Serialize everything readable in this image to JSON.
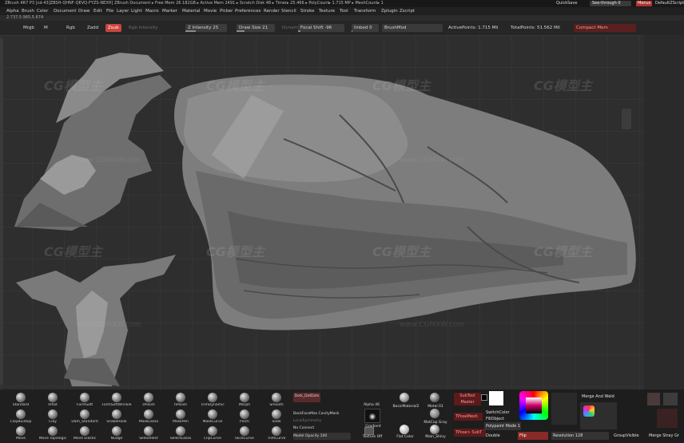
{
  "titlebar": {
    "app_info": "ZBrush 4R7 P3 [cd-43]ZBSH-QHNF-QEVQ-FYZS-NEXH]   ZBrush Document      ▸ Free Mem 26.182GB ▸ Active Mem 2491 ▸ Scratch Disk 48 ▸ Timer▸ 25.466 ▸ PolyCount▸ 1.715 MP ▸ MeshCount▸ 1",
    "quicksave": "QuickSave",
    "see_through": "See-through  0",
    "menus": "Menus",
    "default_script": "DefaultZScript"
  },
  "menubar": {
    "items": [
      "Alpha",
      "Brush",
      "Color",
      "Document",
      "Draw",
      "Edit",
      "File",
      "Layer",
      "Light",
      "Macro",
      "Marker",
      "Material",
      "Movie",
      "Picker",
      "Preferences",
      "Render",
      "Stencil",
      "Stroke",
      "Texture",
      "Tool",
      "Transform",
      "Zplugin",
      "Zscript"
    ]
  },
  "coords": "2.737,5.965,5.674",
  "toolrow": {
    "mrgb": "Mrgb",
    "m": "M",
    "rgb": "Rgb",
    "zadd": "Zadd",
    "zsub": "Zsub",
    "rgb_intensity": "Rgb Intensity",
    "z_intensity": "Z Intensity 25",
    "draw_size": "Draw Size 21",
    "dynamic": "Dynamic",
    "focal_shift": "Focal Shift -96",
    "imbed": "Imbed 0",
    "brushmod": "BrushMod",
    "active_points": "ActivePoints: 1.715 Mil",
    "total_points": "TotalPoints: 51.562 Mil",
    "compact_mem": "Compact Mem"
  },
  "watermarks": {
    "logo": "CG模型主",
    "url": "www.CGMXW.com"
  },
  "palette_left": {
    "brushes": [
      {
        "label": "Standard"
      },
      {
        "label": "Inflat"
      },
      {
        "label": "FormSoft"
      },
      {
        "label": "FormSoftWrinkle"
      },
      {
        "label": "zPolish"
      },
      {
        "label": "hPolish"
      },
      {
        "label": "TrimDynamic"
      },
      {
        "label": "Morph"
      },
      {
        "label": "Smooth"
      },
      {
        "label": "ClayBuildup"
      },
      {
        "label": "Clay"
      },
      {
        "label": "Dam_Standard"
      },
      {
        "label": "SnakeHook"
      },
      {
        "label": "MaskLasso"
      },
      {
        "label": "MaskPen"
      },
      {
        "label": "MaskCurve"
      },
      {
        "label": "Pinch"
      },
      {
        "label": "Slide"
      },
      {
        "label": "Move"
      },
      {
        "label": "Move Topologic"
      },
      {
        "label": "Move Elastic"
      },
      {
        "label": "Nudge"
      },
      {
        "label": "SelectRect"
      },
      {
        "label": "SelectLasso"
      },
      {
        "label": "ClipCurve"
      },
      {
        "label": "SliceCurve"
      },
      {
        "label": "TrimCurve"
      }
    ],
    "stroke_dots": "Dots_DotDots",
    "backface": "BackFaceMas CavityMask",
    "local_symmetry": "LocalSymmetry",
    "no_connect": "No Connect",
    "model_opacity": "Model Opacity 100",
    "alpha": "Alpha 46",
    "gradient": "Gradient",
    "texture_off": "Texture Off",
    "flat_color": "Flat Color",
    "basic_material": "BasicMaterial2",
    "metal_01": "Metal 01",
    "matcap_gray": "MatCap Gray",
    "main_shiny": "Main_Shiny"
  },
  "palette_right": {
    "subtool_master": "SubTool Master",
    "tpose_mesh": "TPoseMesh",
    "tpose_subt": "TPose> SubT",
    "switch_color": "SwitchColor",
    "fill_object": "FillObject",
    "polypaint_mode": "Polypaint Mode 1",
    "double": "Double",
    "flip": "Flip",
    "resolution": "Resolution 128",
    "group_visible": "GroupVisible",
    "merge_stray": "Merge Stray Gr",
    "merge_and_weld": "Merge And Weld"
  },
  "colors": {
    "zadd_active": "#c9463d",
    "menus_button": "#b0322c"
  }
}
